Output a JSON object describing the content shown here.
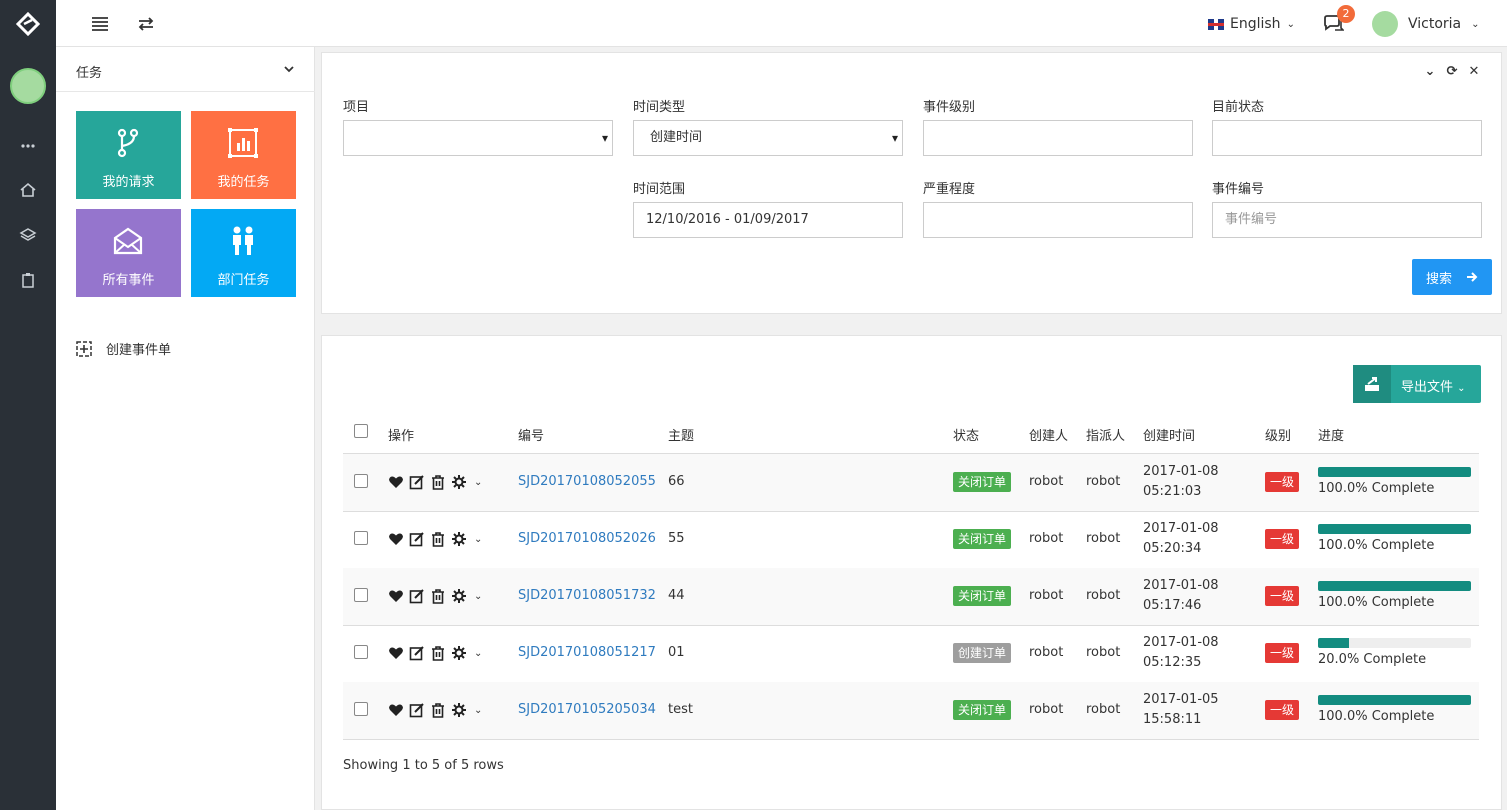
{
  "topbar": {
    "language": "English",
    "notifications_count": "2",
    "user_name": "Victoria"
  },
  "sidebar": {
    "section_title": "任务",
    "tiles": [
      {
        "label": "我的请求",
        "color": "#26a69a"
      },
      {
        "label": "我的任务",
        "color": "#ff7043"
      },
      {
        "label": "所有事件",
        "color": "#9575cd"
      },
      {
        "label": "部门任务",
        "color": "#03a9f4"
      }
    ],
    "create_label": "创建事件单"
  },
  "filter": {
    "project_label": "项目",
    "project_value": "",
    "time_type_label": "时间类型",
    "time_type_value": "创建时间",
    "event_level_label": "事件级别",
    "current_status_label": "目前状态",
    "time_range_label": "时间范围",
    "time_range_value": "12/10/2016 - 01/09/2017",
    "severity_label": "严重程度",
    "event_no_label": "事件编号",
    "event_no_placeholder": "事件编号",
    "search_label": "搜索"
  },
  "table": {
    "export_label": "导出文件",
    "headers": {
      "ops": "操作",
      "id": "编号",
      "subject": "主题",
      "status": "状态",
      "creator": "创建人",
      "assignee": "指派人",
      "created": "创建时间",
      "level": "级别",
      "progress": "进度"
    },
    "rows": [
      {
        "id": "SJD20170108052055",
        "subject": "66",
        "status": "关闭订单",
        "status_color": "#4caf50",
        "creator": "robot",
        "assignee": "robot",
        "date": "2017-01-08",
        "time": "05:21:03",
        "level": "一级",
        "progress": 1.0,
        "progress_label": "100.0% Complete"
      },
      {
        "id": "SJD20170108052026",
        "subject": "55",
        "status": "关闭订单",
        "status_color": "#4caf50",
        "creator": "robot",
        "assignee": "robot",
        "date": "2017-01-08",
        "time": "05:20:34",
        "level": "一级",
        "progress": 1.0,
        "progress_label": "100.0% Complete"
      },
      {
        "id": "SJD20170108051732",
        "subject": "44",
        "status": "关闭订单",
        "status_color": "#4caf50",
        "creator": "robot",
        "assignee": "robot",
        "date": "2017-01-08",
        "time": "05:17:46",
        "level": "一级",
        "progress": 1.0,
        "progress_label": "100.0% Complete"
      },
      {
        "id": "SJD20170108051217",
        "subject": "01",
        "status": "创建订单",
        "status_color": "#9e9e9e",
        "creator": "robot",
        "assignee": "robot",
        "date": "2017-01-08",
        "time": "05:12:35",
        "level": "一级",
        "progress": 0.2,
        "progress_label": "20.0% Complete"
      },
      {
        "id": "SJD20170105205034",
        "subject": "test",
        "status": "关闭订单",
        "status_color": "#4caf50",
        "creator": "robot",
        "assignee": "robot",
        "date": "2017-01-05",
        "time": "15:58:11",
        "level": "一级",
        "progress": 1.0,
        "progress_label": "100.0% Complete"
      }
    ],
    "footer": "Showing 1 to 5 of 5 rows"
  }
}
